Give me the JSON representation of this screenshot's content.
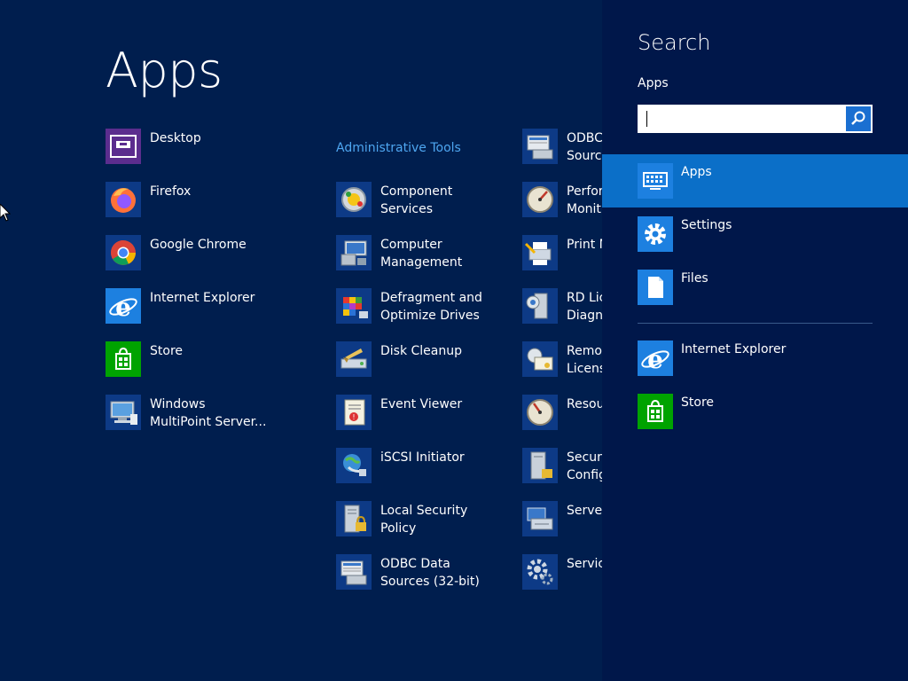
{
  "apps_screen": {
    "title": "Apps",
    "column1": [
      {
        "label": "Desktop",
        "icon": "desktop-icon"
      },
      {
        "label": "Firefox",
        "icon": "firefox-icon"
      },
      {
        "label": "Google Chrome",
        "icon": "chrome-icon"
      },
      {
        "label": "Internet Explorer",
        "icon": "internet-explorer-icon"
      },
      {
        "label": "Store",
        "icon": "store-icon"
      },
      {
        "label": "Windows\nMultiPoint Server...",
        "icon": "multipoint-server-icon"
      }
    ],
    "column2": {
      "group_header": "Administrative Tools",
      "items": [
        {
          "label": "Component\nServices",
          "icon": "component-services-icon"
        },
        {
          "label": "Computer\nManagement",
          "icon": "computer-management-icon"
        },
        {
          "label": "Defragment and\nOptimize Drives",
          "icon": "defragment-icon"
        },
        {
          "label": "Disk Cleanup",
          "icon": "disk-cleanup-icon"
        },
        {
          "label": "Event Viewer",
          "icon": "event-viewer-icon"
        },
        {
          "label": "iSCSI Initiator",
          "icon": "iscsi-initiator-icon"
        },
        {
          "label": "Local Security\nPolicy",
          "icon": "local-security-policy-icon"
        },
        {
          "label": "ODBC Data\nSources (32-bit)",
          "icon": "odbc-icon"
        }
      ]
    },
    "column3": [
      {
        "label": "ODBC\nSourc",
        "icon": "odbc-icon"
      },
      {
        "label": "Perfor\nMonit",
        "icon": "performance-monitor-icon"
      },
      {
        "label": "Print M",
        "icon": "print-management-icon"
      },
      {
        "label": "RD Lic\nDiagn",
        "icon": "rd-licensing-icon"
      },
      {
        "label": "Remot\nLicens",
        "icon": "remote-licensing-icon"
      },
      {
        "label": "Resou",
        "icon": "resource-monitor-icon"
      },
      {
        "label": "Securi\nConfig",
        "icon": "security-config-icon"
      },
      {
        "label": "Server",
        "icon": "server-manager-icon"
      },
      {
        "label": "Servic",
        "icon": "services-icon"
      }
    ]
  },
  "search_charm": {
    "title": "Search",
    "scope_label": "Apps",
    "input_value": "",
    "scopes": [
      {
        "label": "Apps",
        "icon": "keyboard-icon",
        "selected": true
      },
      {
        "label": "Settings",
        "icon": "gear-icon",
        "selected": false
      },
      {
        "label": "Files",
        "icon": "file-icon",
        "selected": false
      }
    ],
    "results": [
      {
        "label": "Internet Explorer",
        "icon": "internet-explorer-icon"
      },
      {
        "label": "Store",
        "icon": "store-icon"
      }
    ]
  },
  "colors": {
    "background": "#001e4e",
    "charm_background": "#00174a",
    "accent": "#0b6fc8",
    "group_header": "#4ea6f0"
  }
}
